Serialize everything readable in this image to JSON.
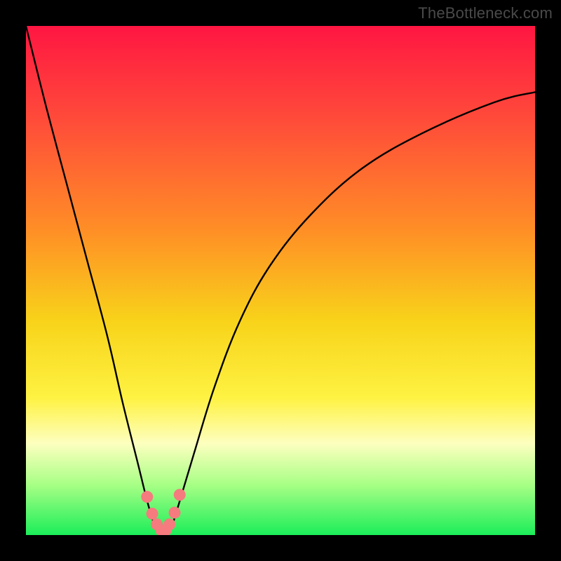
{
  "watermark": "TheBottleneck.com",
  "colors": {
    "background": "#000000",
    "curve_stroke": "#000000",
    "marker_fill": "#f57b7e",
    "gradient_top": "#ff1642",
    "gradient_bottom": "#1bee59"
  },
  "chart_data": {
    "type": "line",
    "title": "",
    "xlabel": "",
    "ylabel": "",
    "xlim": [
      0,
      100
    ],
    "ylim": [
      0,
      100
    ],
    "series": [
      {
        "name": "bottleneck-curve",
        "x": [
          0,
          4,
          8,
          12,
          16,
          19,
          22,
          24,
          25.5,
          27,
          28.5,
          30,
          33,
          37,
          42,
          48,
          56,
          66,
          78,
          92,
          100
        ],
        "y": [
          100,
          84,
          69,
          54,
          39,
          26,
          14,
          6,
          1.5,
          0,
          1.5,
          6,
          16,
          29,
          42,
          53,
          63,
          72,
          79,
          85,
          87
        ]
      }
    ],
    "markers": {
      "name": "highlight-points",
      "x": [
        23.8,
        24.8,
        25.7,
        26.6,
        27.4,
        28.2,
        29.2,
        30.2
      ],
      "y": [
        7.5,
        4.2,
        2.1,
        0.9,
        0.9,
        2.1,
        4.4,
        7.9
      ]
    }
  }
}
